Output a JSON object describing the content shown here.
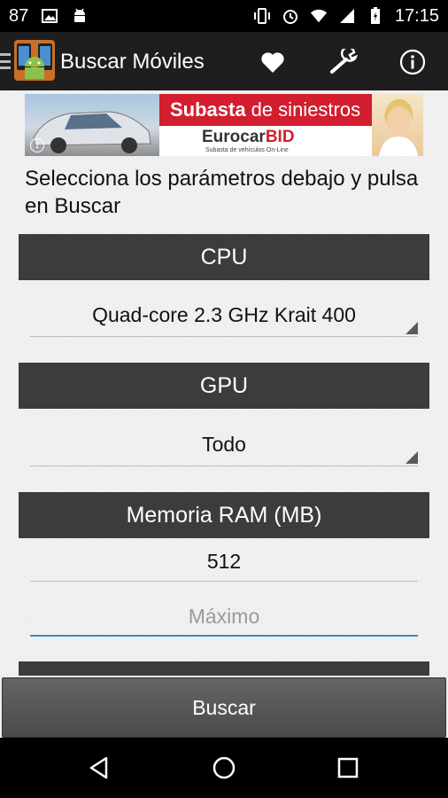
{
  "status_bar": {
    "battery_level_text": "87",
    "time": "17:15"
  },
  "action_bar": {
    "title": "Buscar Móviles",
    "icons": [
      "drawer-icon",
      "app-logo",
      "heart-icon",
      "wrench-icon",
      "info-icon"
    ]
  },
  "ad": {
    "headline_bold": "Subasta",
    "headline_light": "de siniestros",
    "brand_a": "Eurocar",
    "brand_b": "BID",
    "tagline": "Subasta de vehículos On-Line",
    "info_glyph": "i"
  },
  "form": {
    "instructions": "Selecciona los parámetros debajo y pulsa en Buscar",
    "cpu": {
      "header": "CPU",
      "selected": "Quad-core 2.3 GHz Krait 400"
    },
    "gpu": {
      "header": "GPU",
      "selected": "Todo"
    },
    "ram": {
      "header": "Memoria RAM (MB)",
      "min_value": "512",
      "max_placeholder": "Máximo"
    }
  },
  "buttons": {
    "search": "Buscar"
  },
  "colors": {
    "action_bar": "#1e1e1e",
    "section_header": "#3c3c3c",
    "focus_underline": "#2b8fd4",
    "ad_red": "#d21e2e"
  }
}
